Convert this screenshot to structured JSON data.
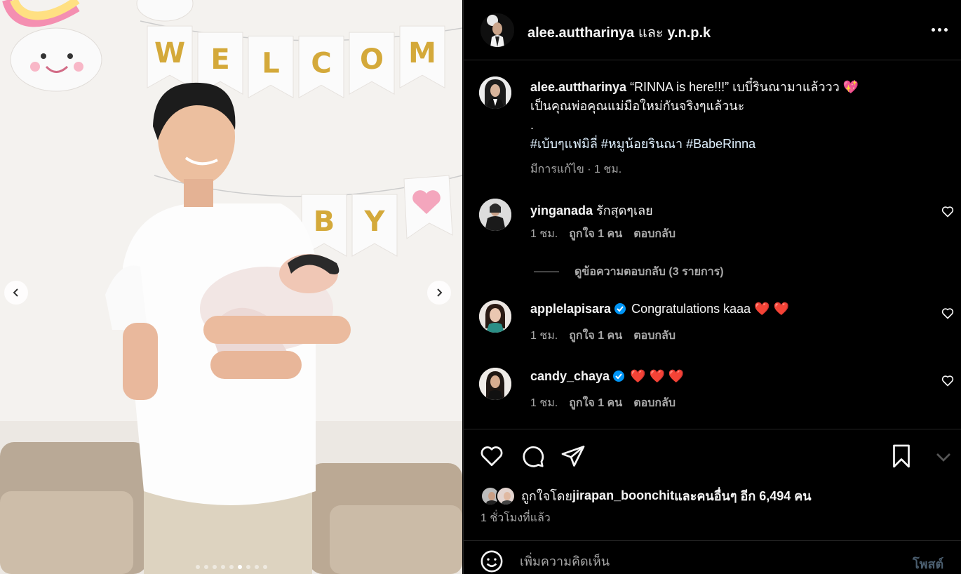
{
  "photo": {
    "banner_top": [
      "W",
      "E",
      "L",
      "C",
      "O",
      "M"
    ],
    "banner_bottom": [
      "B",
      "Y"
    ],
    "total_slides": 9,
    "active_slide": 6
  },
  "header": {
    "author": "alee.auttharinya",
    "joiner": " และ ",
    "coauthor": "y.n.p.k"
  },
  "caption": {
    "user": "alee.auttharinya",
    "line1": " “RINNA is here!!!” เบบี๋รินณามาแล้ววว 💖",
    "line2": "เป็นคุณพ่อคุณแม่มือใหม่กันจริงๆแล้วนะ",
    "line3": ".",
    "hashtags": "#เบ้บๆแฟมิลี่ #หมูน้อยรินณา #BabeRinna",
    "meta": "มีการแก้ไข · 1 ชม."
  },
  "comments": [
    {
      "user": "yinganada",
      "verified": false,
      "text": " รักสุดๆเลย",
      "time": "1 ชม.",
      "likes": "ถูกใจ 1 คน",
      "reply": "ตอบกลับ"
    },
    {
      "user": "applelapisara",
      "verified": true,
      "text": " Congratulations kaaa ❤️ ❤️",
      "time": "1 ชม.",
      "likes": "ถูกใจ 1 คน",
      "reply": "ตอบกลับ"
    },
    {
      "user": "candy_chaya",
      "verified": true,
      "text": " ❤️ ❤️ ❤️",
      "time": "1 ชม.",
      "likes": "ถูกใจ 1 คน",
      "reply": "ตอบกลับ"
    }
  ],
  "view_replies": "ดูข้อความตอบกลับ (3 รายการ)",
  "likes": {
    "prefix": "ถูกใจโดย ",
    "user": "jirapan_boonchit",
    "middle": " และ",
    "suffix": "คนอื่นๆ อีก 6,494 คน"
  },
  "post_time": "1 ชั่วโมงที่แล้ว",
  "comment_box": {
    "placeholder": "เพิ่มความคิดเห็น",
    "post_label": "โพสต์"
  },
  "colors": {
    "background": "#000000",
    "text": "#f5f5f5",
    "muted": "#a8a8a8",
    "verified": "#0095f6",
    "post_disabled": "#4a5d6e"
  },
  "icons": [
    "more-icon",
    "heart-icon",
    "comment-icon",
    "share-icon",
    "bookmark-icon",
    "emoji-icon",
    "chevron-left-icon",
    "chevron-right-icon",
    "verified-icon"
  ]
}
